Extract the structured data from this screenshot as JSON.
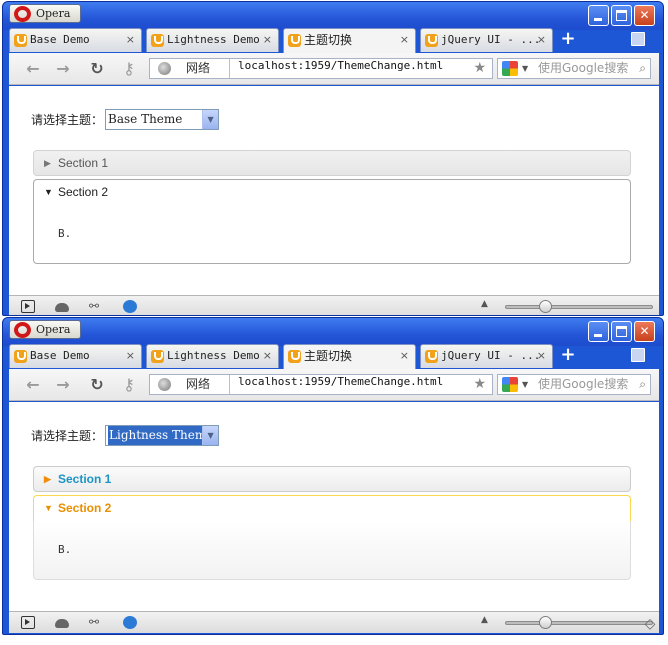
{
  "windows": [
    {
      "opera_button": "Opera",
      "tabs": [
        {
          "label": "Base Demo",
          "close": "×"
        },
        {
          "label": "Lightness Demo",
          "close": "×"
        },
        {
          "label": "主题切换",
          "close": "×"
        },
        {
          "label": "jQuery UI - ...",
          "close": "×"
        }
      ],
      "new_tab": "+",
      "address": {
        "zone": "网络",
        "url": "localhost:1959/ThemeChange.html"
      },
      "search": {
        "placeholder": "使用Google搜索"
      },
      "page": {
        "theme_label": "请选择主题：",
        "theme_selected": "Base Theme",
        "sections": [
          {
            "title": "Section 1",
            "expanded": false
          },
          {
            "title": "Section 2",
            "expanded": true,
            "content": "B."
          }
        ]
      }
    },
    {
      "opera_button": "Opera",
      "tabs": [
        {
          "label": "Base Demo",
          "close": "×"
        },
        {
          "label": "Lightness Demo",
          "close": "×"
        },
        {
          "label": "主题切换",
          "close": "×"
        },
        {
          "label": "jQuery UI - ...",
          "close": "×"
        }
      ],
      "new_tab": "+",
      "address": {
        "zone": "网络",
        "url": "localhost:1959/ThemeChange.html"
      },
      "search": {
        "placeholder": "使用Google搜索"
      },
      "page": {
        "theme_label": "请选择主题：",
        "theme_selected": "Lightness Theme",
        "sections": [
          {
            "title": "Section 1",
            "expanded": false
          },
          {
            "title": "Section 2",
            "expanded": true,
            "content": "B."
          }
        ]
      }
    }
  ],
  "colors": {
    "window_frame": "#1e57d6",
    "base_header_text": "#555555",
    "lightness_header_text": "#1c94c4",
    "lightness_active_text": "#eb8f00",
    "lightness_active_border": "#fbd850"
  }
}
